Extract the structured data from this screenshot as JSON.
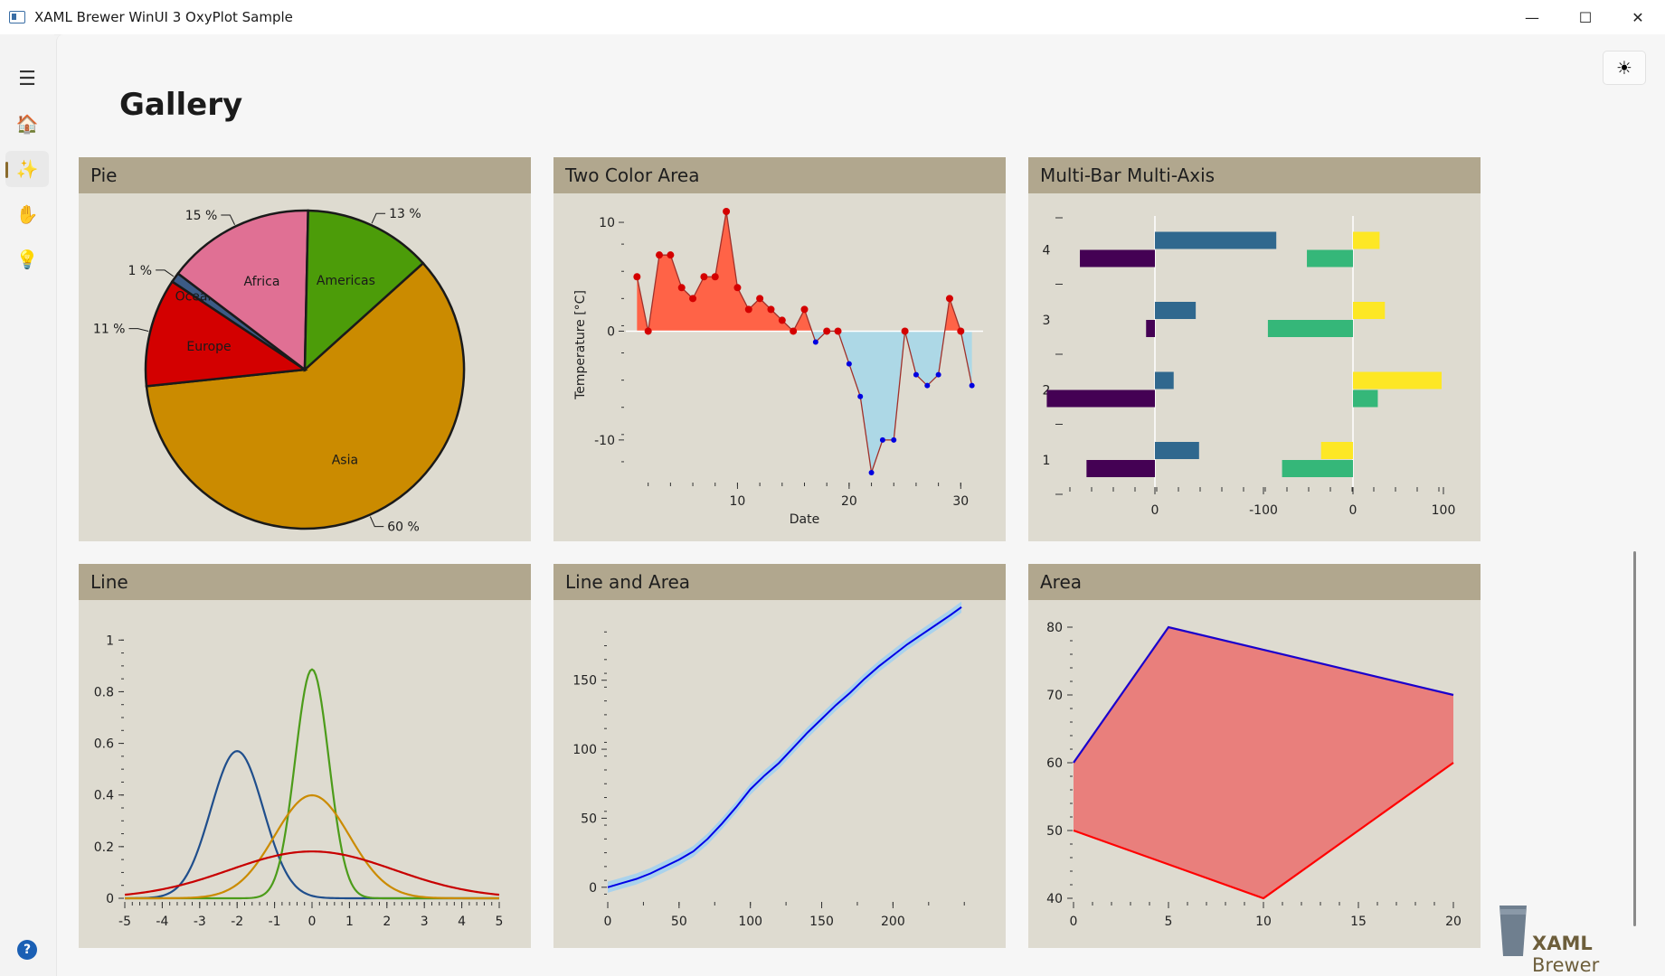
{
  "window": {
    "title": "XAML Brewer WinUI 3 OxyPlot Sample",
    "minimize_glyph": "—",
    "maximize_glyph": "☐",
    "close_glyph": "✕"
  },
  "sidebar": {
    "items": [
      {
        "icon": "hamburger-menu-icon",
        "glyph": "☰"
      },
      {
        "icon": "home-icon",
        "glyph": "🏠"
      },
      {
        "icon": "sparkle-icon",
        "glyph": "✨",
        "selected": true
      },
      {
        "icon": "hand-icon",
        "glyph": "✋"
      },
      {
        "icon": "lightbulb-icon",
        "glyph": "💡"
      }
    ],
    "help_glyph": "?"
  },
  "header": {
    "title": "Gallery",
    "theme_glyph": "☀"
  },
  "brand": {
    "part1": "XAML",
    "part2": " Brewer"
  },
  "colors": {
    "accent": "#8a6b2d",
    "card_header": "#b1a78e",
    "card_body": "#dedbd0",
    "area_fill": "#e97f7c"
  },
  "cards": {
    "pie": {
      "title": "Pie"
    },
    "two_color_area": {
      "title": "Two Color Area"
    },
    "multi_bar": {
      "title": "Multi-Bar Multi-Axis"
    },
    "line": {
      "title": "Line"
    },
    "line_area": {
      "title": "Line and Area"
    },
    "area": {
      "title": "Area"
    }
  },
  "chart_data": [
    {
      "type": "pie",
      "slices": [
        {
          "label": "Asia",
          "percent": 60,
          "pct_label": "60 %",
          "color": "#cb8b00"
        },
        {
          "label": "Europe",
          "percent": 11,
          "pct_label": "11 %",
          "color": "#d30000"
        },
        {
          "label": "Oceania",
          "percent": 1,
          "pct_label": "1 %",
          "color": "#3c5b86"
        },
        {
          "label": "Africa",
          "percent": 15,
          "pct_label": "15 %",
          "color": "#e07094"
        },
        {
          "label": "Americas",
          "percent": 13,
          "pct_label": "13 %",
          "color": "#4c9c09"
        }
      ]
    },
    {
      "type": "area",
      "xlabel": "Date",
      "ylabel": "Temperature [°C]",
      "xlim": [
        0,
        32
      ],
      "ylim": [
        -13.5,
        11
      ],
      "x_ticks": [
        10,
        20,
        30
      ],
      "y_ticks": [
        10,
        0,
        -10
      ],
      "x": [
        1,
        2,
        3,
        4,
        5,
        6,
        7,
        8,
        9,
        10,
        11,
        12,
        13,
        14,
        15,
        16,
        17,
        18,
        19,
        20,
        21,
        22,
        23,
        24,
        25,
        26,
        27,
        28,
        29,
        30,
        31
      ],
      "y": [
        5,
        0,
        7,
        7,
        4,
        3,
        5,
        5,
        11,
        4,
        2,
        3,
        2,
        1,
        0,
        2,
        -1,
        0,
        0,
        -3,
        -6,
        -13,
        -10,
        -10,
        0,
        -4,
        -5,
        -4,
        3,
        0,
        -5
      ],
      "positive_color": "#ff6347",
      "negative_color": "#add8e6"
    },
    {
      "type": "bar",
      "orientation": "horizontal",
      "categories": [
        "1",
        "2",
        "3",
        "4"
      ],
      "axis_ticks_left": [
        "0",
        "-100",
        "0",
        "100"
      ],
      "left_series": [
        {
          "color": "#30688e",
          "values": [
            40,
            17,
            37,
            110
          ]
        },
        {
          "color": "#440154",
          "values": [
            62,
            98,
            8,
            68
          ]
        }
      ],
      "right_series": [
        {
          "color": "#fde725",
          "values": [
            -36,
            100,
            36,
            30
          ]
        },
        {
          "color": "#35b779",
          "values": [
            -80,
            28,
            -96,
            -52
          ]
        }
      ]
    },
    {
      "type": "line",
      "xlim": [
        -5,
        5
      ],
      "ylim": [
        0,
        1.05
      ],
      "x_ticks": [
        "-5",
        "-4",
        "-3",
        "-2",
        "-1",
        "0",
        "1",
        "2",
        "3",
        "4",
        "5"
      ],
      "y_ticks": [
        "0",
        "0.2",
        "0.4",
        "0.6",
        "0.8",
        "1"
      ],
      "series": [
        {
          "mu": -2,
          "sigma": 0.7,
          "color": "#1f4e8c"
        },
        {
          "mu": 0,
          "sigma": 0.45,
          "color": "#4c9c1a"
        },
        {
          "mu": 0,
          "sigma": 1.0,
          "color": "#cb8b00"
        },
        {
          "mu": 0,
          "sigma": 2.2,
          "color": "#c80000"
        }
      ]
    },
    {
      "type": "area",
      "xlim": [
        0,
        260
      ],
      "ylim": [
        -8,
        195
      ],
      "x_ticks": [
        "0",
        "50",
        "100",
        "150",
        "200"
      ],
      "y_ticks": [
        "0",
        "50",
        "100",
        "150"
      ],
      "x": [
        0,
        10,
        20,
        30,
        40,
        50,
        60,
        70,
        80,
        90,
        100,
        110,
        120,
        130,
        140,
        150,
        160,
        170,
        180,
        190,
        200,
        210,
        220,
        230,
        240,
        248
      ],
      "y": [
        0,
        3,
        6,
        10,
        15,
        20,
        26,
        35,
        46,
        58,
        71,
        81,
        90,
        101,
        112,
        122,
        132,
        141,
        151,
        160,
        168,
        176,
        183,
        190,
        197,
        203
      ],
      "line_color": "#0000e6",
      "band_color": "#a9d2ec"
    },
    {
      "type": "area",
      "xlim": [
        0,
        20
      ],
      "ylim": [
        40,
        80
      ],
      "x_ticks": [
        "0",
        "5",
        "10",
        "15",
        "20"
      ],
      "y_ticks": [
        "40",
        "50",
        "60",
        "70",
        "80"
      ],
      "upper": {
        "x": [
          0,
          5,
          20
        ],
        "y": [
          60,
          80,
          70
        ],
        "color": "#1a00cc"
      },
      "lower": {
        "x": [
          0,
          10,
          20
        ],
        "y": [
          50,
          40,
          60
        ],
        "color": "#ff0000"
      },
      "fill": "#e97f7c"
    }
  ]
}
